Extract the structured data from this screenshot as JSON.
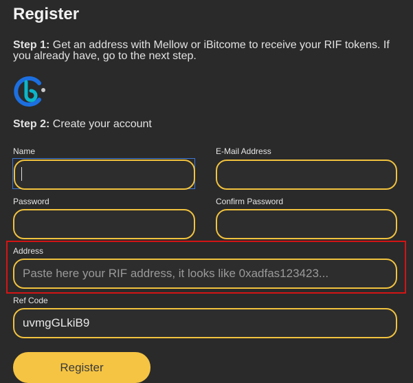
{
  "page": {
    "title": "Register"
  },
  "step1": {
    "label": "Step 1:",
    "text": " Get an address with Mellow or iBitcome to receive your RIF tokens. If you already have, go to the next step."
  },
  "logo": {
    "icon": "ibitcome-logo-icon",
    "colors": [
      "#1c6fe0",
      "#0bb6c9",
      "#c9c9c9"
    ]
  },
  "step2": {
    "label": "Step 2:",
    "text": " Create your account"
  },
  "form": {
    "name": {
      "label": "Name",
      "value": "",
      "placeholder": ""
    },
    "email": {
      "label": "E-Mail Address",
      "value": "",
      "placeholder": ""
    },
    "password": {
      "label": "Password",
      "value": "",
      "placeholder": ""
    },
    "confirm_password": {
      "label": "Confirm Password",
      "value": "",
      "placeholder": ""
    },
    "address": {
      "label": "Address",
      "value": "",
      "placeholder": "Paste here your RIF address, it looks like 0xadfas123423..."
    },
    "ref_code": {
      "label": "Ref Code",
      "value": "uvmgGLkiB9",
      "placeholder": ""
    }
  },
  "actions": {
    "register_label": "Register"
  },
  "colors": {
    "background": "#2a2a2a",
    "accent": "#f2c33e",
    "focus": "#3f78d6",
    "highlight": "#d41414"
  }
}
